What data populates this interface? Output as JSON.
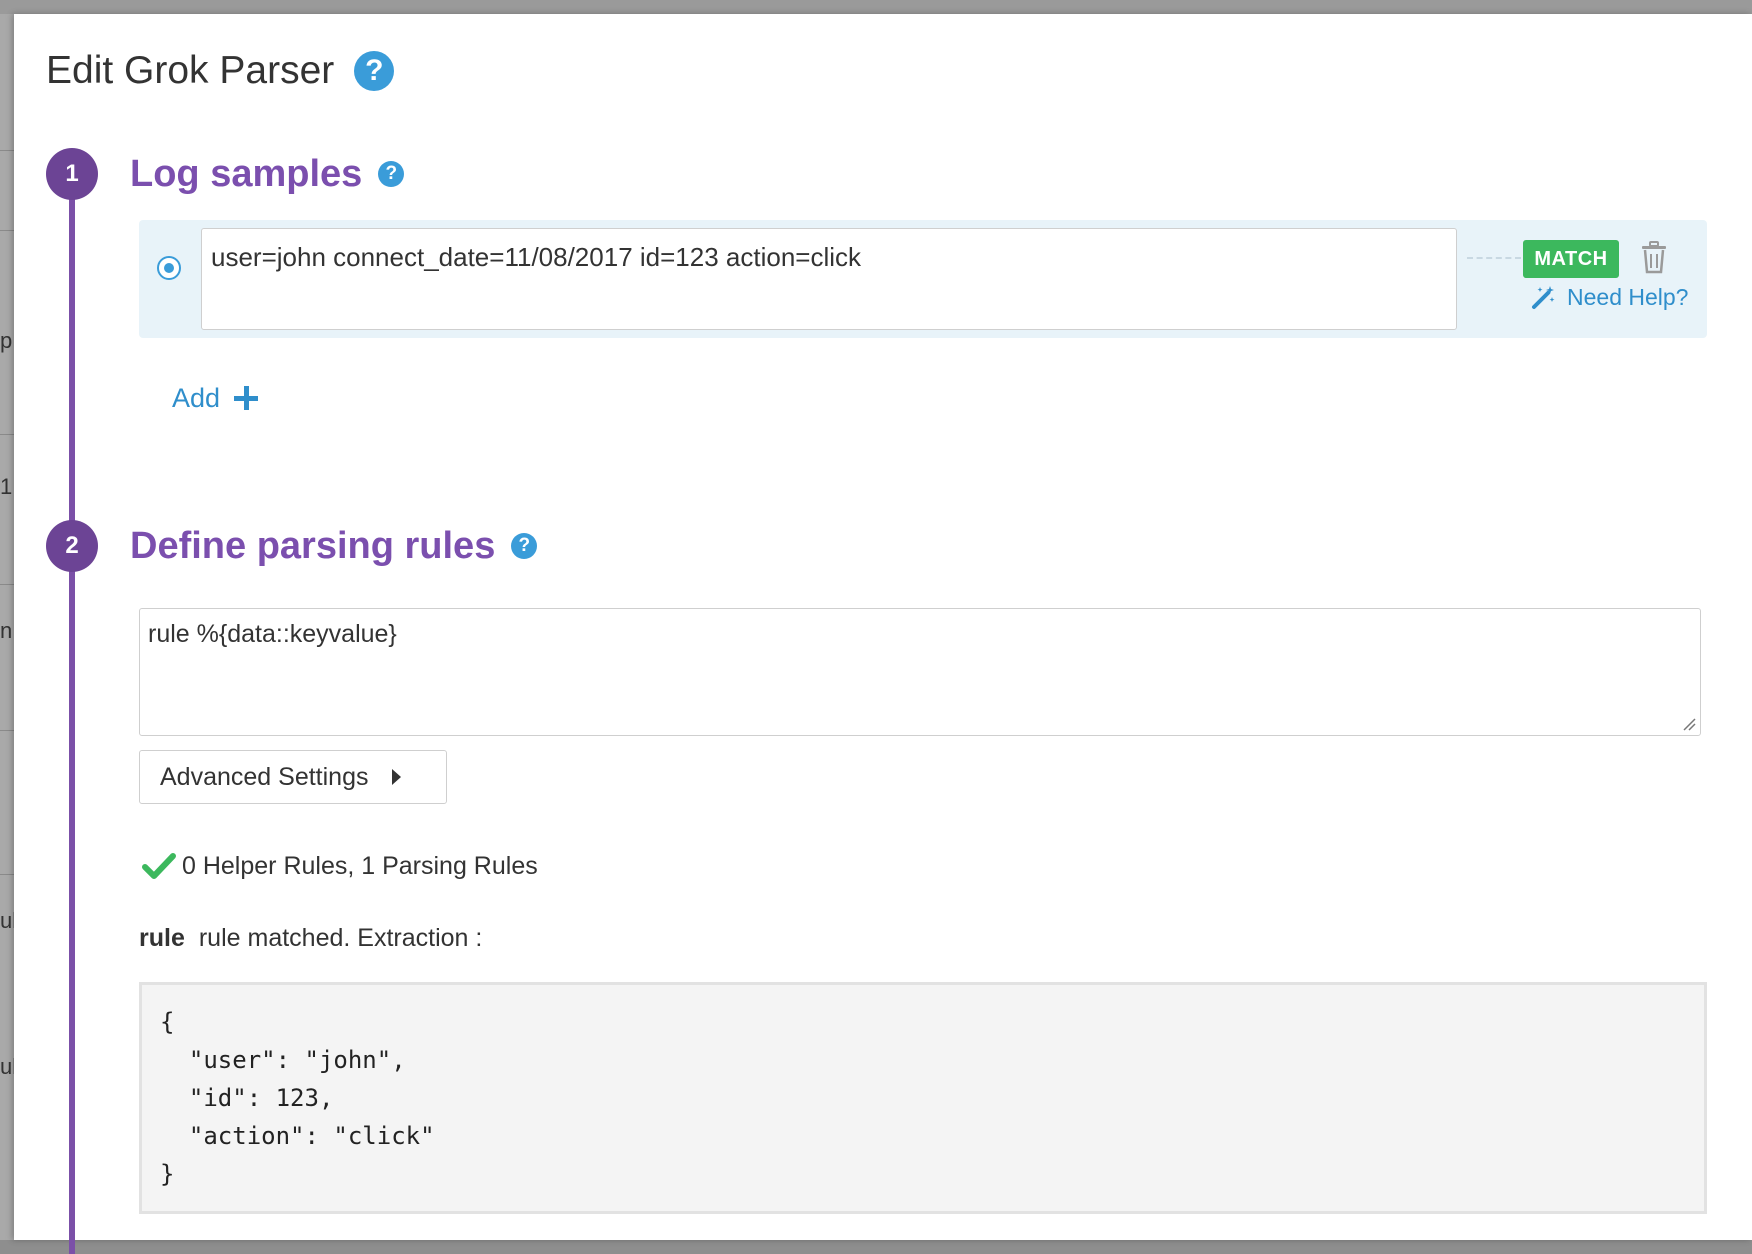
{
  "background_page": {
    "fragments": [
      "p",
      "1",
      "n",
      "ul",
      "ul"
    ]
  },
  "modal": {
    "title": "Edit Grok Parser",
    "help_glyph": "?"
  },
  "steps": [
    {
      "number": "1",
      "title": "Log samples",
      "help_glyph": "?"
    },
    {
      "number": "2",
      "title": "Define parsing rules",
      "help_glyph": "?"
    }
  ],
  "log_samples": {
    "items": [
      {
        "text": "user=john connect_date=11/08/2017 id=123 action=click",
        "status": "MATCH",
        "need_help_label": "Need Help?"
      }
    ],
    "add_label": "Add"
  },
  "parsing_rules": {
    "rules_text": "rule %{data::keyvalue}",
    "advanced_settings_label": "Advanced Settings",
    "summary": "0 Helper Rules, 1 Parsing Rules",
    "match_rule_name": "rule",
    "match_message": "rule matched. Extraction :",
    "extraction": "{\n  \"user\": \"john\",\n  \"id\": 123,\n  \"action\": \"click\"\n}"
  },
  "colors": {
    "accent_purple": "#7b4fae",
    "link_blue": "#2f8ecb",
    "match_green": "#3cb85d"
  },
  "icons": [
    "help-icon",
    "radio-selected-icon",
    "trash-icon",
    "magic-wand-icon",
    "plus-icon",
    "caret-right-icon",
    "checkmark-icon",
    "resize-grip-icon"
  ]
}
